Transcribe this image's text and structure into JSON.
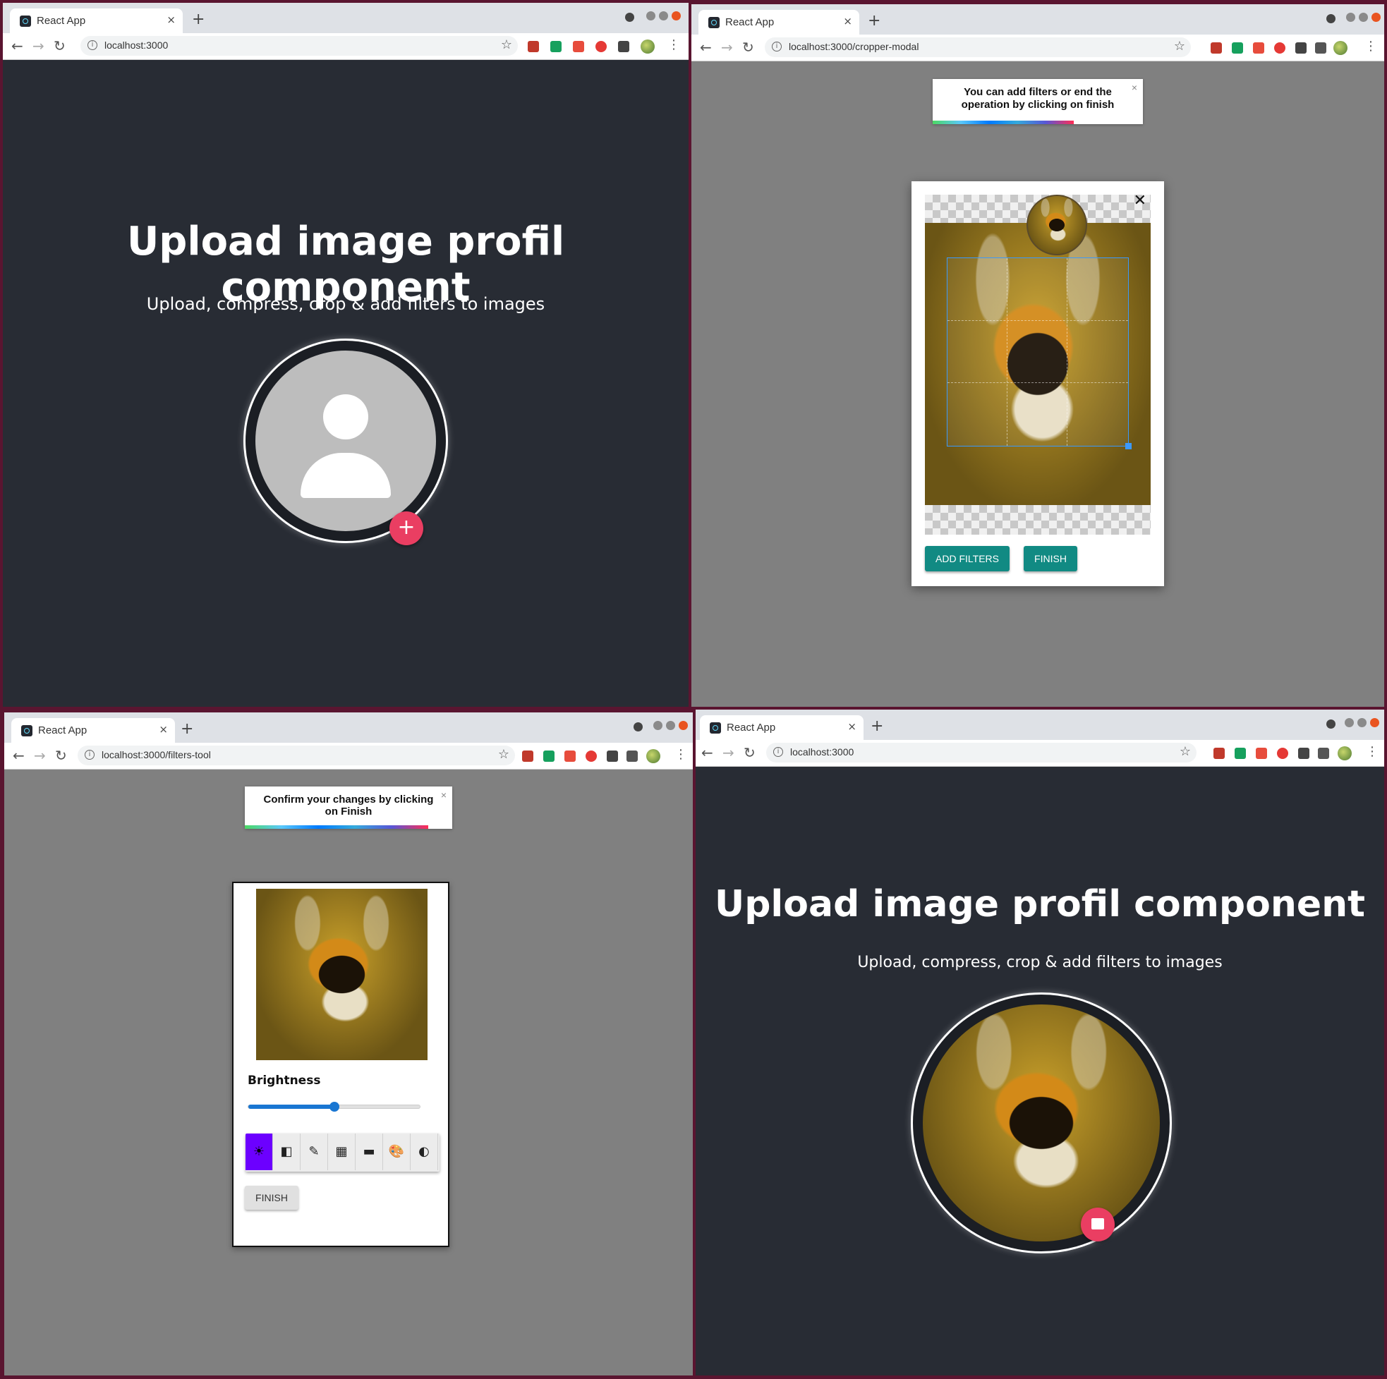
{
  "tab_title": "React App",
  "tab_close": "×",
  "new_tab": "+",
  "star": "☆",
  "kebab": "⋮",
  "nav_back": "←",
  "nav_forward": "→",
  "nav_reload": "↻",
  "info": "i",
  "windows": {
    "w1": {
      "url": "localhost:3000"
    },
    "w2": {
      "url": "localhost:3000/cropper-modal"
    },
    "w3": {
      "url": "localhost:3000/filters-tool"
    },
    "w4": {
      "url": "localhost:3000"
    }
  },
  "hero": {
    "title": "Upload image profil component",
    "subtitle": "Upload, compress, crop & add filters to images",
    "add_symbol": "+"
  },
  "cropper": {
    "toast": "You can add filters or end the operation by clicking on finish",
    "toast_close": "×",
    "close_symbol": "✕",
    "add_filters": "ADD FILTERS",
    "finish": "FINISH"
  },
  "filters": {
    "toast": "Confirm your changes by clicking on Finish",
    "toast_close": "×",
    "label": "Brightness",
    "slider_value_fraction": 0.5,
    "finish": "FINISH",
    "tools": [
      {
        "icon": "brightness-icon",
        "glyph": "☀"
      },
      {
        "icon": "contrast-icon",
        "glyph": "◧"
      },
      {
        "icon": "eyedropper-icon",
        "glyph": "✎"
      },
      {
        "icon": "grain-icon",
        "glyph": "▦"
      },
      {
        "icon": "image-icon",
        "glyph": "▬"
      },
      {
        "icon": "palette-icon",
        "glyph": "🎨"
      },
      {
        "icon": "tone-icon",
        "glyph": "◐"
      }
    ]
  },
  "colors": {
    "accent_fab": "#ea3e62",
    "teal": "#118a83",
    "active_tool": "#6c00ff",
    "slider": "#1976d2"
  }
}
